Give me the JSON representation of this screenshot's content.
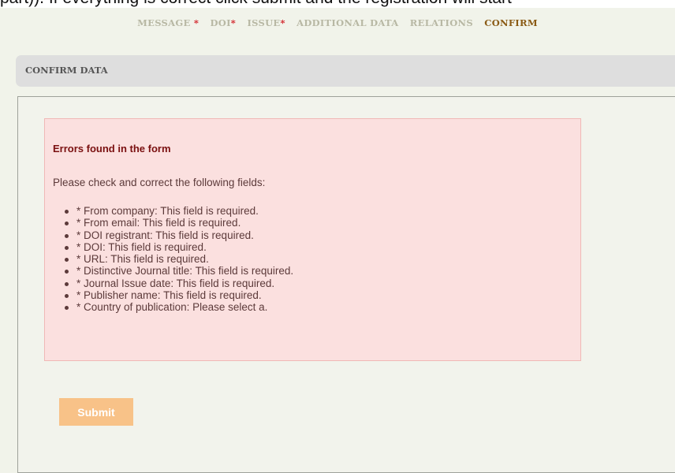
{
  "top_text": "part)). If everything is correct click submit and the registration will start",
  "steps": {
    "message": "MESSAGE",
    "doi": "DOI",
    "issue": "ISSUE",
    "additional_data": "ADDITIONAL DATA",
    "relations": "RELATIONS",
    "confirm": "CONFIRM",
    "required_mark": "*"
  },
  "section": {
    "title": "CONFIRM DATA"
  },
  "errors": {
    "title": "Errors found in the form",
    "intro": "Please check and correct the following fields:",
    "items": [
      "* From company: This field is required.",
      "* From email: This field is required.",
      "* DOI registrant: This field is required.",
      "* DOI: This field is required.",
      "* URL: This field is required.",
      "* Distinctive Journal title: This field is required.",
      "* Journal Issue date: This field is required.",
      "* Publisher name: This field is required.",
      "* Country of publication: Please select a."
    ]
  },
  "actions": {
    "submit_label": "Submit"
  },
  "colors": {
    "accent_active_step": "#8a5a14",
    "required_mark": "#d2232a",
    "error_bg": "#fbe0df",
    "submit_bg": "#f8c288"
  }
}
